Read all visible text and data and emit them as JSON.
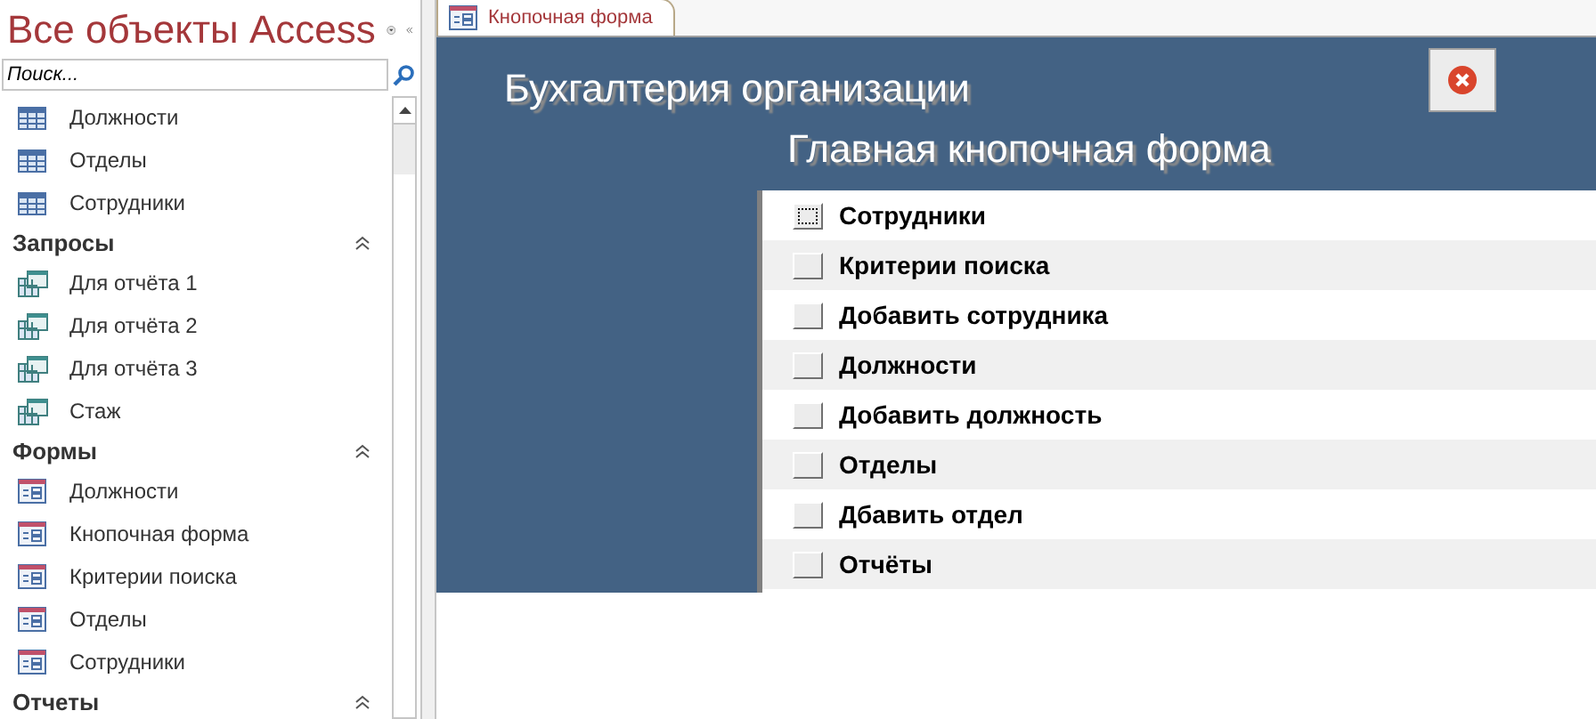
{
  "nav": {
    "title": "Все объекты Access",
    "search": {
      "placeholder": "Поиск..."
    },
    "groups": [
      {
        "items": [
          {
            "kind": "table",
            "label": "Должности"
          },
          {
            "kind": "table",
            "label": "Отделы"
          },
          {
            "kind": "table",
            "label": "Сотрудники"
          }
        ]
      },
      {
        "title": "Запросы",
        "items": [
          {
            "kind": "query",
            "label": "Для отчёта 1"
          },
          {
            "kind": "query",
            "label": "Для отчёта 2"
          },
          {
            "kind": "query",
            "label": "Для отчёта 3"
          },
          {
            "kind": "query",
            "label": "Стаж"
          }
        ]
      },
      {
        "title": "Формы",
        "items": [
          {
            "kind": "form",
            "label": "Должности"
          },
          {
            "kind": "form",
            "label": "Кнопочная форма"
          },
          {
            "kind": "form",
            "label": "Критерии поиска"
          },
          {
            "kind": "form",
            "label": "Отделы"
          },
          {
            "kind": "form",
            "label": "Сотрудники"
          }
        ]
      },
      {
        "title": "Отчеты"
      }
    ]
  },
  "tabs": [
    {
      "label": "Кнопочная форма",
      "selected": true
    }
  ],
  "form": {
    "title": "Бухгалтерия организации",
    "subtitle": "Главная кнопочная форма",
    "menu": [
      {
        "label": "Сотрудники",
        "selected": true
      },
      {
        "label": "Критерии поиска",
        "selected": false
      },
      {
        "label": "Добавить сотрудника",
        "selected": false
      },
      {
        "label": "Должности",
        "selected": false
      },
      {
        "label": "Добавить должность",
        "selected": false
      },
      {
        "label": "Отделы",
        "selected": false
      },
      {
        "label": "Дбавить отдел",
        "selected": false
      },
      {
        "label": "Отчёты",
        "selected": false
      }
    ]
  }
}
